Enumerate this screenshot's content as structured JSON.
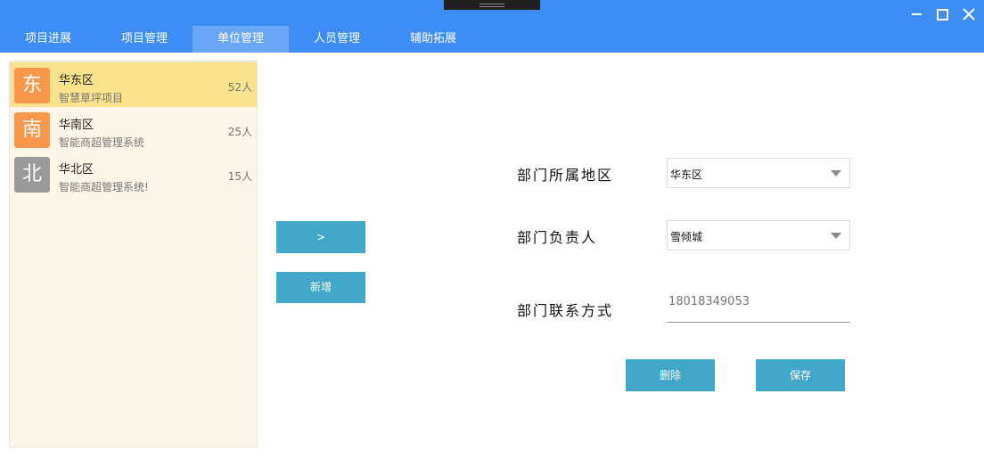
{
  "window": {
    "icons": [
      "drag-handle-icon",
      "minimize-icon",
      "maximize-icon",
      "close-icon"
    ]
  },
  "tabs": [
    {
      "label": "项目进展",
      "active": false
    },
    {
      "label": "项目管理",
      "active": false
    },
    {
      "label": "单位管理",
      "active": true
    },
    {
      "label": "人员管理",
      "active": false
    },
    {
      "label": "辅助拓展",
      "active": false
    }
  ],
  "units": [
    {
      "avatar": "东",
      "avatar_color": "#f9984b",
      "name": "华东区",
      "project": "智慧草坪项目",
      "count": "52人",
      "selected": true
    },
    {
      "avatar": "南",
      "avatar_color": "#f9984b",
      "name": "华南区",
      "project": "智能商超管理系统",
      "count": "25人",
      "selected": false
    },
    {
      "avatar": "北",
      "avatar_color": "#9a9a9a",
      "name": "华北区",
      "project": "智能商超管理系统!",
      "count": "15人",
      "selected": false
    }
  ],
  "actions": {
    "arrow_label": ">",
    "add_label": "新增",
    "delete_label": "删除",
    "save_label": "保存"
  },
  "form": {
    "region_label": "部门所属地区",
    "region_value": "华东区",
    "manager_label": "部门负责人",
    "manager_value": "雪倾城",
    "contact_label": "部门联系方式",
    "contact_value": "18018349053"
  },
  "colors": {
    "titlebar": "#3d8df5",
    "active_tab": "#69a6f7",
    "button": "#41a8c9",
    "list_bg": "#fdf6e8",
    "selected_item": "#fae38c"
  }
}
